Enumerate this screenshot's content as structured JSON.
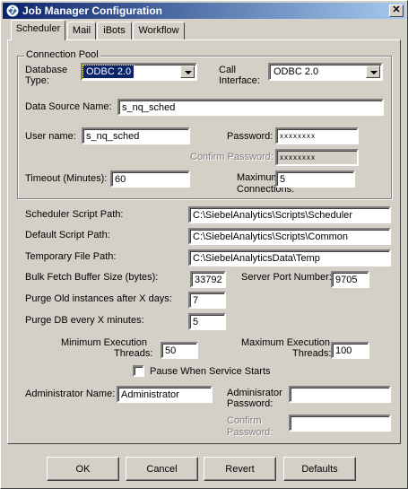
{
  "window": {
    "title": "Job Manager Configuration",
    "close_glyph": "✕"
  },
  "tabs": [
    {
      "label": "Scheduler",
      "active": true
    },
    {
      "label": "Mail"
    },
    {
      "label": "iBots"
    },
    {
      "label": "Workflow"
    }
  ],
  "connection_pool": {
    "group_label": "Connection Pool",
    "database_type": {
      "label_line1": "Database",
      "label_line2": "Type:",
      "value": "ODBC 2.0"
    },
    "call_interface": {
      "label_line1": "Call",
      "label_line2": "Interface:",
      "value": "ODBC 2.0"
    },
    "data_source_name": {
      "label": "Data Source Name:",
      "value": "s_nq_sched"
    },
    "user_name": {
      "label": "User name:",
      "value": "s_nq_sched"
    },
    "password": {
      "label": "Password:",
      "value": "xxxxxxxx"
    },
    "confirm_password": {
      "label": "Confirm Password:",
      "value": "xxxxxxxx"
    },
    "timeout": {
      "label": "Timeout (Minutes):",
      "value": "60"
    },
    "max_connections": {
      "label_line1": "Maximum",
      "label_line2": "Connections:",
      "value": "5"
    }
  },
  "scheduler": {
    "script_path": {
      "label": "Scheduler Script Path:",
      "value": "C:\\SiebelAnalytics\\Scripts\\Scheduler"
    },
    "default_script_path": {
      "label": "Default Script Path:",
      "value": "C:\\SiebelAnalytics\\Scripts\\Common"
    },
    "temp_file_path": {
      "label": "Temporary File Path:",
      "value": "C:\\SiebelAnalyticsData\\Temp"
    },
    "bulk_fetch": {
      "label": "Bulk Fetch Buffer Size (bytes):",
      "value": "33792"
    },
    "server_port": {
      "label": "Server Port Number:",
      "value": "9705"
    },
    "purge_old": {
      "label": "Purge Old instances after X days:",
      "value": "7"
    },
    "purge_db": {
      "label": "Purge DB every X minutes:",
      "value": "5"
    },
    "min_threads": {
      "label_line1": "Minimum Execution",
      "label_line2": "Threads:",
      "value": "50"
    },
    "max_threads": {
      "label_line1": "Maximum Execution",
      "label_line2": "Threads:",
      "value": "100"
    },
    "pause_checkbox": {
      "label": "Pause When Service Starts",
      "checked": false
    },
    "admin_name": {
      "label": "Administrator Name:",
      "value": "Administrator"
    },
    "admin_password": {
      "label_line1": "Adminisrator",
      "label_line2": "Password:",
      "value": ""
    },
    "admin_confirm": {
      "label_line1": "Confirm",
      "label_line2": "Password:",
      "value": ""
    }
  },
  "buttons": {
    "ok": "OK",
    "cancel": "Cancel",
    "revert": "Revert",
    "defaults": "Defaults"
  }
}
